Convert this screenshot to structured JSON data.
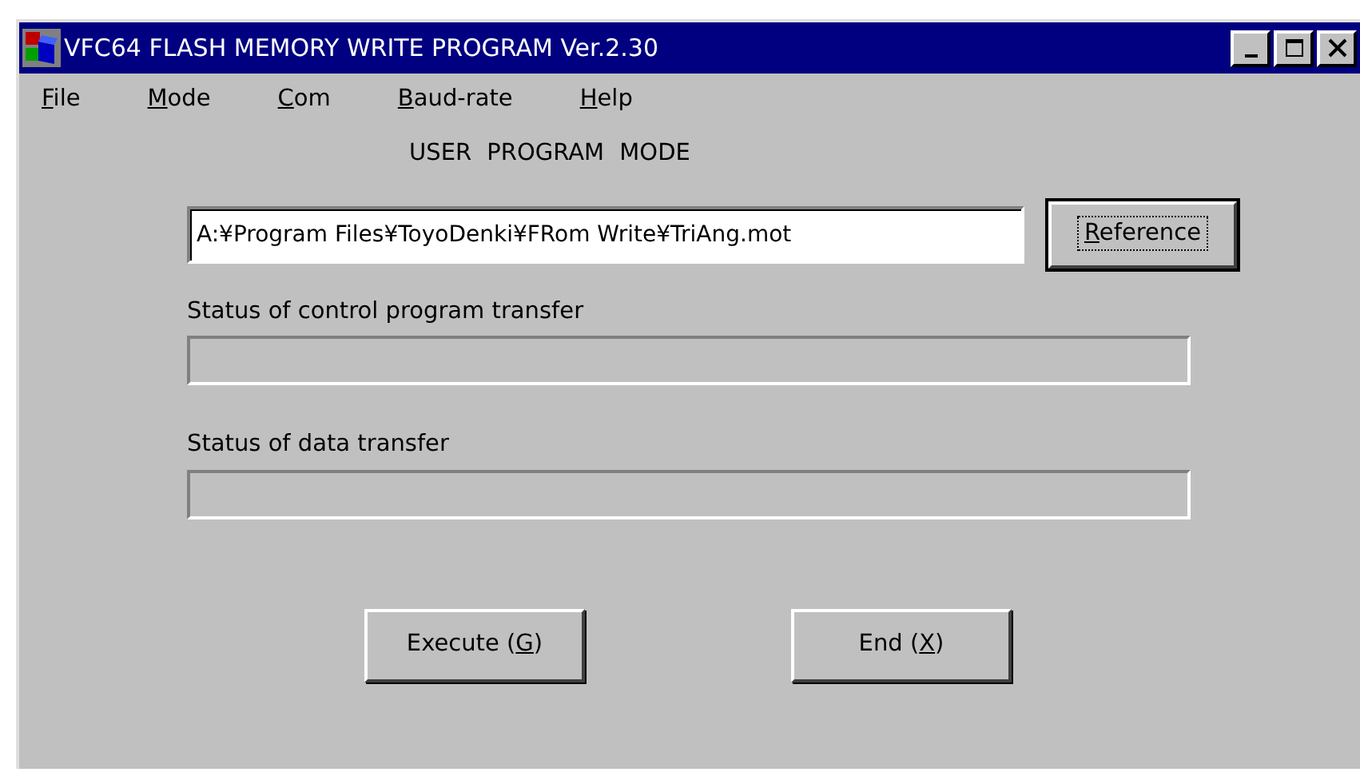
{
  "window": {
    "title": "VFC64 FLASH MEMORY WRITE PROGRAM Ver.2.30"
  },
  "menu": [
    {
      "mnemonic": "F",
      "rest": "ile"
    },
    {
      "mnemonic": "M",
      "rest": "ode"
    },
    {
      "mnemonic": "C",
      "rest": "om"
    },
    {
      "mnemonic": "B",
      "rest": "aud-rate"
    },
    {
      "mnemonic": "H",
      "rest": "elp"
    }
  ],
  "mode_label": "USER PROGRAM MODE",
  "file_path": {
    "value": "A:¥Program Files¥ToyoDenki¥FRom Write¥TriAng.mot"
  },
  "reference_button": {
    "mnemonic": "R",
    "after": "eference",
    "focused": true
  },
  "progress": [
    {
      "label": "Status of control program transfer",
      "level": 0
    },
    {
      "label": "Status of data transfer",
      "level": 0
    }
  ],
  "buttons": [
    {
      "before": "Execute (",
      "mnemonic": "G",
      "after": ")"
    },
    {
      "before": "End (",
      "mnemonic": "X",
      "after": ")"
    }
  ]
}
